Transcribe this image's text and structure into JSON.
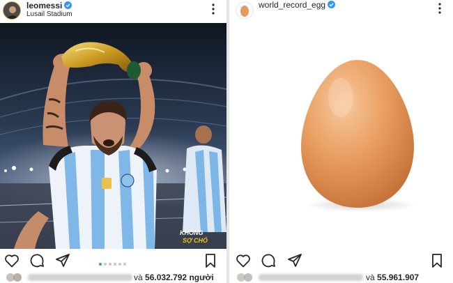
{
  "posts": [
    {
      "username": "leomessi",
      "location": "Lusail Stadium",
      "watermark": "KHÔNG SỢ CHÓ",
      "likes": {
        "prefix": "và",
        "count": "56.032.792",
        "suffix": "người"
      },
      "carousel": {
        "total": 6,
        "active": 1
      }
    },
    {
      "username": "world_record_egg",
      "likes": {
        "prefix": "và",
        "count": "55.961.907",
        "suffix": ""
      }
    }
  ],
  "colors": {
    "verified": "#3897f0",
    "text": "#262626",
    "egg": "#e79a58",
    "divider": "#e6e6e6"
  },
  "icons": [
    "more-options-icon",
    "heart-icon",
    "comment-icon",
    "share-icon",
    "bookmark-icon",
    "verified-badge-icon"
  ]
}
